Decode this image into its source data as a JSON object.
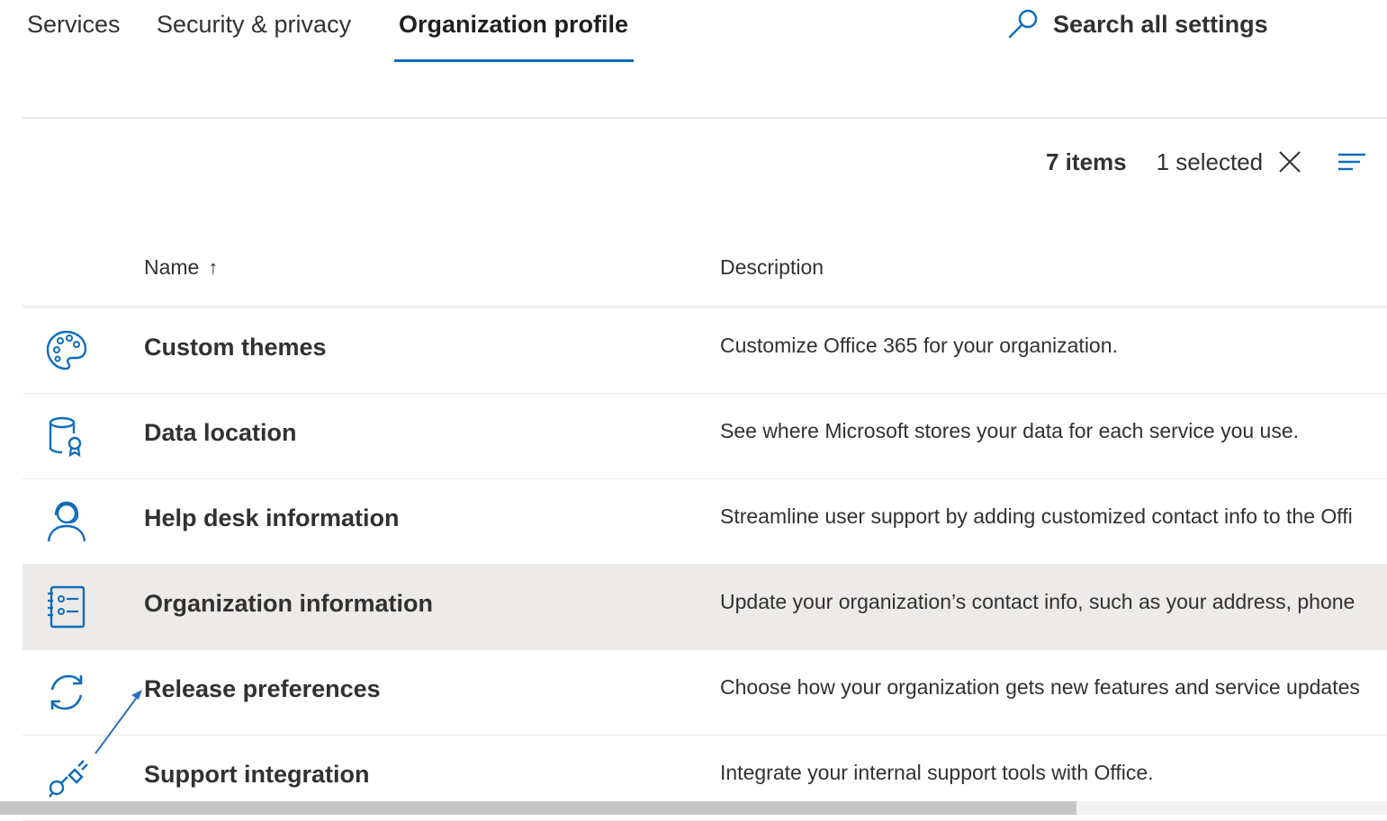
{
  "tabs": [
    {
      "label": "Services"
    },
    {
      "label": "Security & privacy"
    },
    {
      "label": "Organization profile"
    }
  ],
  "search": {
    "label": "Search all settings"
  },
  "toolbar": {
    "items_count": "7 items",
    "selected_count": "1 selected"
  },
  "columns": {
    "name": "Name",
    "sort_indicator": "↑",
    "description": "Description"
  },
  "rows": [
    {
      "name": "Custom themes",
      "description": "Customize Office 365 for your organization.",
      "icon": "palette-icon"
    },
    {
      "name": "Data location",
      "description": "See where Microsoft stores your data for each service you use.",
      "icon": "database-location-icon"
    },
    {
      "name": "Help desk information",
      "description": "Streamline user support by adding customized contact info to the Offi",
      "icon": "headset-person-icon"
    },
    {
      "name": "Organization information",
      "description": "Update your organization’s contact info, such as your address, phone",
      "icon": "contact-card-icon"
    },
    {
      "name": "Release preferences",
      "description": "Choose how your organization gets new features and service updates",
      "icon": "sync-icon"
    },
    {
      "name": "Support integration",
      "description": "Integrate your internal support tools with Office.",
      "icon": "plug-connection-icon"
    }
  ],
  "colors": {
    "accent": "#0f6cbd",
    "selected_row": "#edebe9",
    "text": "#323130"
  }
}
